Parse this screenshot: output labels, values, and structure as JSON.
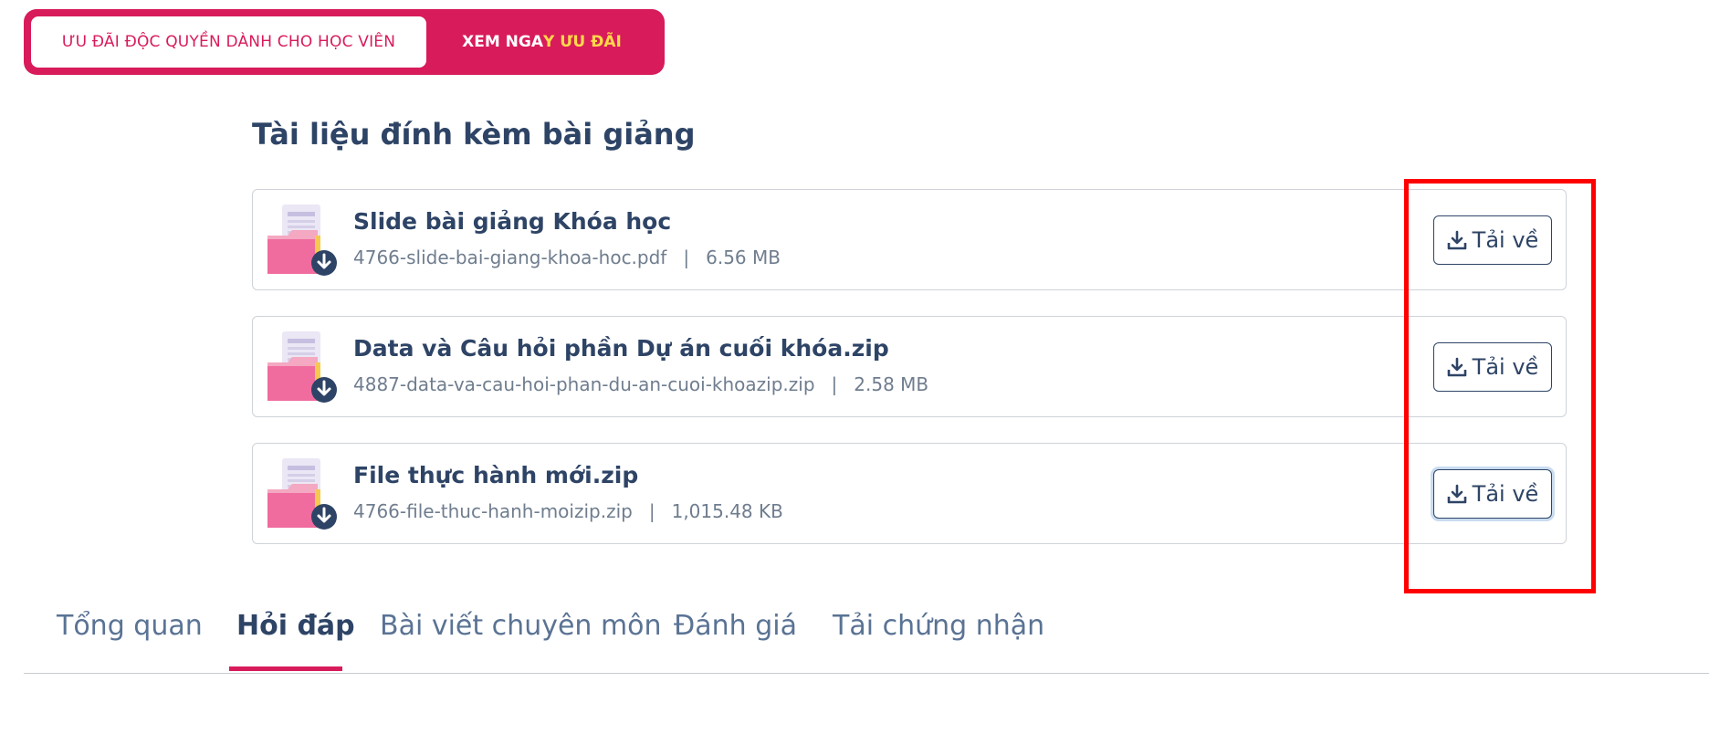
{
  "promo": {
    "left_text": "ƯU ĐÃI ĐỘC QUYỀN DÀNH CHO HỌC VIÊN",
    "right_text_part1": "XEM NGA",
    "right_text_part2": "Y ƯU ĐÃI",
    "accent_color": "#d81b5b",
    "highlight_color": "#ffd84a"
  },
  "attachments_section": {
    "title": "Tài liệu đính kèm bài giảng",
    "items": [
      {
        "title": "Slide bài giảng Khóa học",
        "filename": "4766-slide-bai-giang-khoa-hoc.pdf",
        "separator": "|",
        "size": "6.56 MB",
        "button_label": "Tải về",
        "icon": "folder-download-icon"
      },
      {
        "title": "Data và Câu hỏi phần Dự án cuối khóa.zip",
        "filename": "4887-data-va-cau-hoi-phan-du-an-cuoi-khoazip.zip",
        "separator": "|",
        "size": "2.58 MB",
        "button_label": "Tải về",
        "icon": "folder-download-icon"
      },
      {
        "title": "File thực hành mới.zip",
        "filename": "4766-file-thuc-hanh-moizip.zip",
        "separator": "|",
        "size": "1,015.48 KB",
        "button_label": "Tải về",
        "icon": "folder-download-icon"
      }
    ]
  },
  "tabs": [
    {
      "label": "Tổng quan",
      "active": false
    },
    {
      "label": "Hỏi đáp",
      "active": true
    },
    {
      "label": "Bài viết chuyên môn",
      "active": false
    },
    {
      "label": "Đánh giá",
      "active": false
    },
    {
      "label": "Tải chứng nhận",
      "active": false
    }
  ],
  "colors": {
    "text_dark": "#2e4466",
    "text_muted": "#6f7d8e",
    "tab_inactive": "#5a7394",
    "annotation_red": "#ff0000"
  }
}
